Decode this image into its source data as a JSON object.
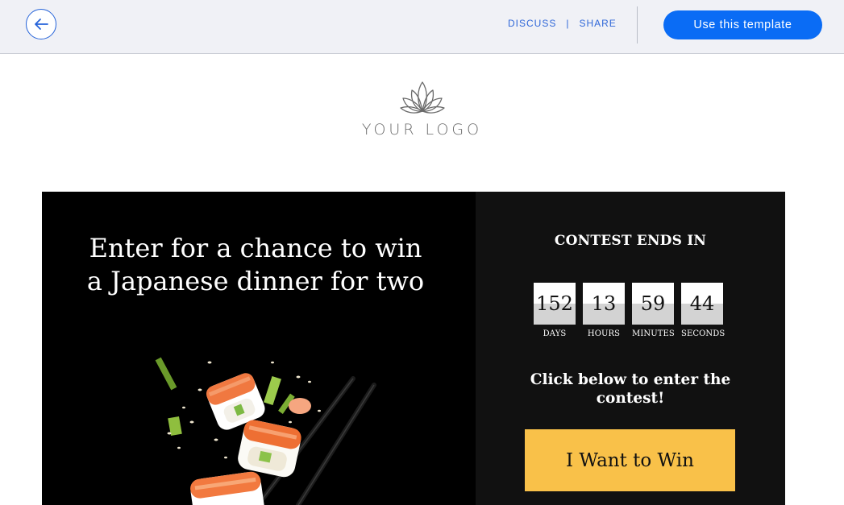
{
  "topbar": {
    "back_icon": "arrow-left-icon",
    "discuss_label": "DISCUSS",
    "separator": "|",
    "share_label": "SHARE",
    "cta_label": "Use this template",
    "accent_color": "#0a6cf5"
  },
  "logo": {
    "icon": "lotus-icon",
    "text": "YOUR LOGO"
  },
  "hero": {
    "title_line1": "Enter for a chance to win",
    "title_line2": "a Japanese dinner for two",
    "image": "sushi-chopsticks-image"
  },
  "contest": {
    "title": "CONTEST ENDS IN",
    "countdown": [
      {
        "value": "152",
        "label": "DAYS"
      },
      {
        "value": "13",
        "label": "HOURS"
      },
      {
        "value": "59",
        "label": "MINUTES"
      },
      {
        "value": "44",
        "label": "SECONDS"
      }
    ],
    "prompt": "Click below to enter the contest!",
    "button_label": "I Want to Win",
    "button_color": "#f9c149"
  }
}
